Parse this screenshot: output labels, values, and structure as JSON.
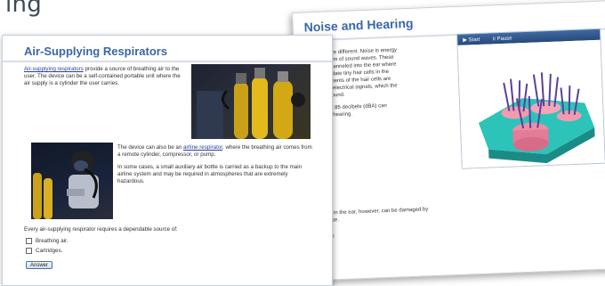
{
  "header": {
    "title_fragment": "ing"
  },
  "back": {
    "title": "Noise and Hearing",
    "para1": "d hearing are different.  Noise is energy\nes in the form of sound waves.  These\naves are channeled into the ear where\ne and stimulate tiny hair cells in the\n  The movements of the hair cells are\nverted into electrical signals, which the\nrprets as sound.",
    "para2": "hat exceed 85 decibels (dBA) can\ns person's hearing.",
    "para3": "hair cells in the ear, however, can be damaged by\n____ noise.",
    "para4": "requency.",
    "player": {
      "start": "Start",
      "pause": "Pause"
    }
  },
  "front": {
    "title": "Air-Supplying Respirators",
    "para1_link": "Air-supplying respirators",
    "para1_rest": " provide a source of breathing air to the user.  The device can be a self-contained portable unit where the air supply is a cylinder the user carries.",
    "para2_pre": "The device can also be an ",
    "para2_link": "airline respirator",
    "para2_post": ", where the breathing air comes from a remote cylinder, compressor, or pump.",
    "para3": "In some cases, a small auxiliary air bottle is carried as a backup to the main airline system and may be required in atmospheres that are extremely hazardous.",
    "question": "Every air-supplying respirator requires a dependable source of:",
    "options": [
      "Breathing air.",
      "Cartridges."
    ],
    "answer_label": "Answer"
  },
  "colors": {
    "title": "#3a66a8",
    "link": "#2a3e9c",
    "player_bar": "#325a8f"
  }
}
